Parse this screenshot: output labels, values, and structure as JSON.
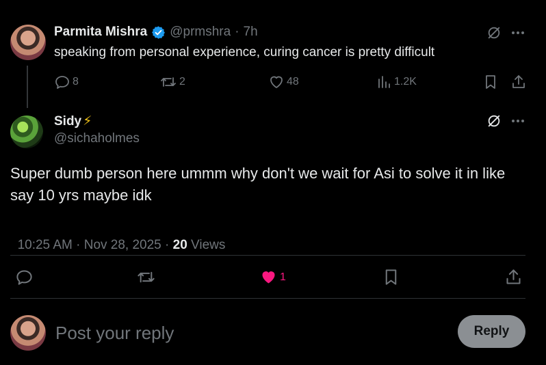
{
  "parent_tweet": {
    "author_name": "Parmita Mishra",
    "author_handle": "@prmshra",
    "time_sep": "·",
    "time": "7h",
    "text": "speaking from personal experience, curing cancer is pretty difficult",
    "replies": "8",
    "retweets": "2",
    "likes": "48",
    "views": "1.2K"
  },
  "main_tweet": {
    "author_name": "Sidy",
    "name_emoji": "⚡",
    "author_handle": "@sichaholmes",
    "text": "Super dumb person here ummm why don't we wait for Asi to solve it in like say 10 yrs maybe idk",
    "timestamp": "10:25 AM · Nov 28, 2025 · ",
    "views_count": "20",
    "views_label": " Views",
    "likes": "1"
  },
  "reply_box": {
    "placeholder": "Post your reply",
    "button_label": "Reply"
  },
  "colors": {
    "background": "#000000",
    "text_primary": "#e7e9ea",
    "text_secondary": "#71767b",
    "verified": "#1d9bf0",
    "like_active": "#f91880",
    "divider": "#2f3336"
  }
}
